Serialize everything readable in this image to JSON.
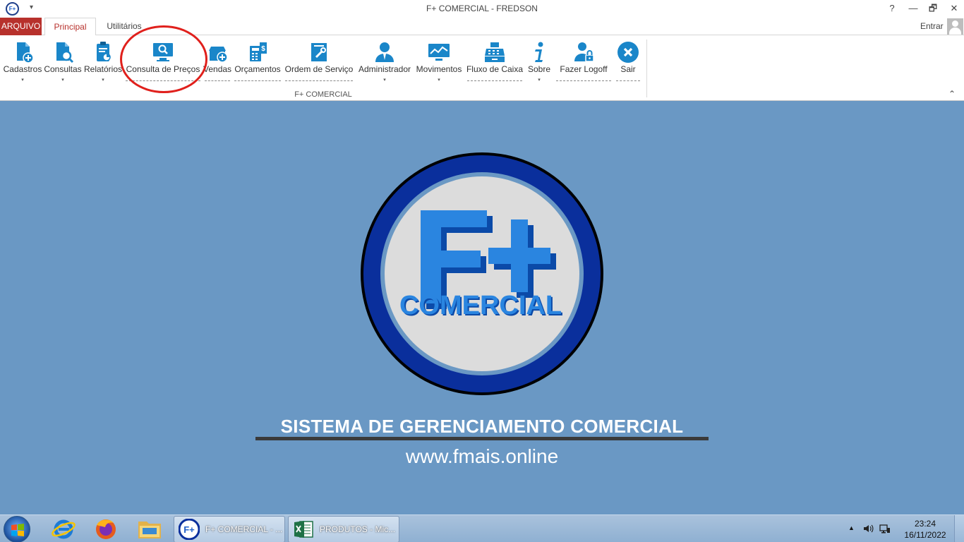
{
  "window": {
    "title": "F+ COMERCIAL - FREDSON",
    "app_icon_text": "F+",
    "help": "?",
    "minimize": "—",
    "restore": "🗗",
    "close": "✕",
    "qat_arrow": "▾"
  },
  "tabs": {
    "arquivo": "ARQUIVO",
    "principal": "Principal",
    "utilitarios": "Utilitários",
    "active": "Principal"
  },
  "account": {
    "signin": "Entrar"
  },
  "ribbon": {
    "group_label": "F+ COMERCIAL",
    "collapse": "⌃",
    "dropdown_glyph": "▾",
    "buttons": [
      {
        "label": "Cadastros",
        "icon": "document-add-icon"
      },
      {
        "label": "Consultas",
        "icon": "document-search-icon"
      },
      {
        "label": "Relatórios",
        "icon": "clipboard-report-icon"
      },
      {
        "label": "Consulta de Preços",
        "icon": "monitor-search-icon"
      },
      {
        "label": "Vendas",
        "icon": "sales-icon"
      },
      {
        "label": "Orçamentos",
        "icon": "calculator-icon"
      },
      {
        "label": "Ordem de Serviço",
        "icon": "service-order-icon"
      },
      {
        "label": "Administrador",
        "icon": "admin-user-icon"
      },
      {
        "label": "Movimentos",
        "icon": "chart-monitor-icon"
      },
      {
        "label": "Fluxo de Caixa",
        "icon": "cash-register-icon"
      },
      {
        "label": "Sobre",
        "icon": "info-icon"
      },
      {
        "label": "Fazer Logoff",
        "icon": "user-lock-icon"
      },
      {
        "label": "Sair",
        "icon": "close-circle-icon"
      }
    ]
  },
  "main": {
    "logo_big": "F+",
    "logo_word": "COMERCIAL",
    "tagline": "SISTEMA DE GERENCIAMENTO COMERCIAL",
    "website": "www.fmais.online"
  },
  "taskbar": {
    "pinned": [
      "internet-explorer-icon",
      "firefox-icon",
      "file-explorer-icon"
    ],
    "tasks": [
      {
        "label": "F+ COMERCIAL - ...",
        "icon": "fplus-app-icon"
      },
      {
        "label": "PRODUTOS - Mic...",
        "icon": "excel-icon"
      }
    ],
    "tray_arrow": "▲",
    "time": "23:24",
    "date": "16/11/2022"
  },
  "colors": {
    "accent": "#b7312c",
    "ribbon_icon": "#1a86c9",
    "background": "#6a98c4",
    "logo_blue": "#2a85e0",
    "logo_ring": "#0a2f9c",
    "annotation_circle": "#e0201c"
  }
}
